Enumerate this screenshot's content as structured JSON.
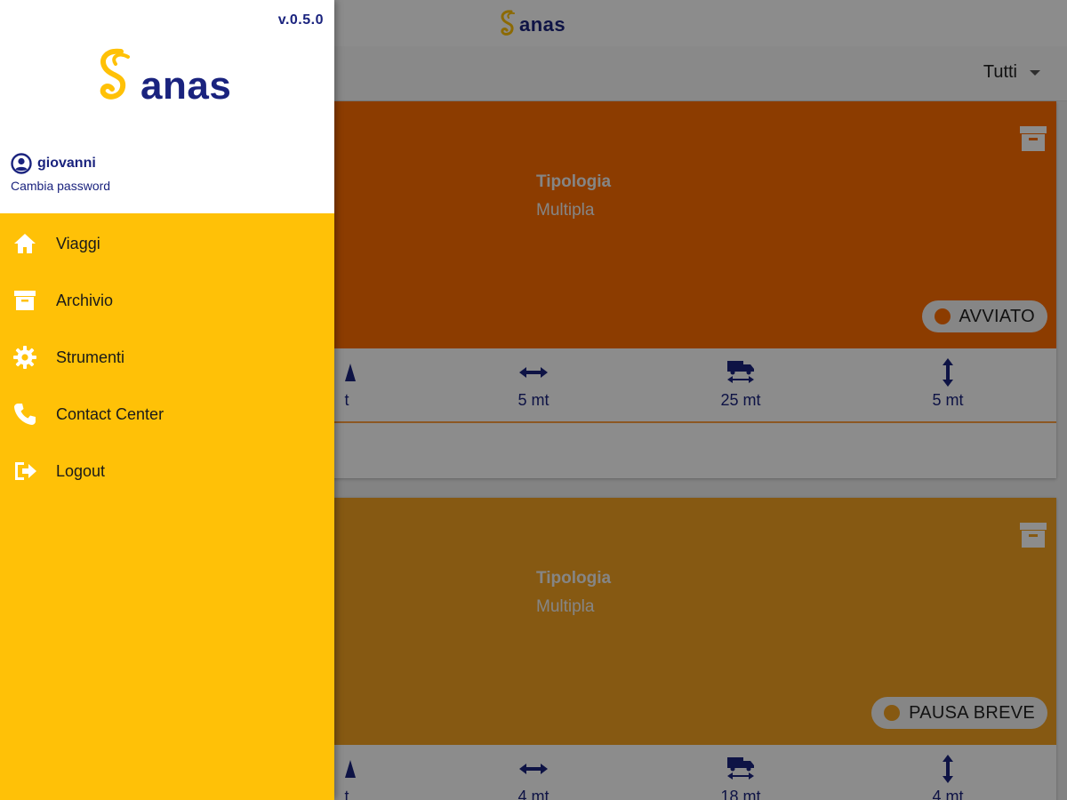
{
  "app": {
    "brand": "anas",
    "accent_color": "#ffc107",
    "brand_color": "#1a237e"
  },
  "filter": {
    "selected": "Tutti"
  },
  "cards": [
    {
      "type_label": "Tipologia",
      "type_value": "Multipla",
      "status": "AVVIATO",
      "header_color": "#ff6d00",
      "dims": [
        {
          "icon": "height-triangle-icon",
          "value": "t"
        },
        {
          "icon": "width-arrow-icon",
          "value": "5 mt"
        },
        {
          "icon": "truck-length-icon",
          "value": "25 mt"
        },
        {
          "icon": "height-arrow-icon",
          "value": "5 mt"
        }
      ]
    },
    {
      "type_label": "Tipologia",
      "type_value": "Multipla",
      "status": "PAUSA BREVE",
      "header_color": "#f4a322",
      "dims": [
        {
          "icon": "height-triangle-icon",
          "value": "t"
        },
        {
          "icon": "width-arrow-icon",
          "value": "4 mt"
        },
        {
          "icon": "truck-length-icon",
          "value": "18 mt"
        },
        {
          "icon": "height-arrow-icon",
          "value": "4 mt"
        }
      ]
    }
  ],
  "drawer": {
    "version": "v.0.5.0",
    "brand": "anas",
    "user": {
      "name": "giovanni",
      "change_password": "Cambia password"
    },
    "menu": [
      {
        "label": "Viaggi",
        "icon": "home-icon"
      },
      {
        "label": "Archivio",
        "icon": "archive-icon"
      },
      {
        "label": "Strumenti",
        "icon": "gear-icon"
      },
      {
        "label": "Contact Center",
        "icon": "phone-icon"
      },
      {
        "label": "Logout",
        "icon": "logout-icon"
      }
    ]
  }
}
